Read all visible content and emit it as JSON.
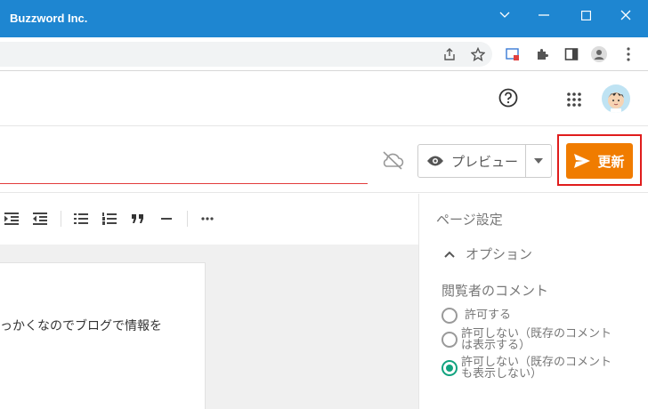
{
  "window": {
    "title": "Buzzword Inc."
  },
  "editor": {
    "preview_label": "プレビュー",
    "update_label": "更新",
    "body_text": "っかくなのでブログで情報を"
  },
  "sidebar": {
    "title": "ページ設定",
    "options_label": "オプション",
    "comments_label": "閲覧者のコメント",
    "radios": [
      {
        "line1": "許可する",
        "line2": "",
        "checked": false
      },
      {
        "line1": "許可しない（既存のコメント",
        "line2": "は表示する）",
        "checked": false
      },
      {
        "line1": "許可しない（既存のコメント",
        "line2": "も表示しない）",
        "checked": true
      }
    ]
  },
  "colors": {
    "titlebar": "#1e86d1",
    "accent": "#f07c00",
    "radio_checked": "#11a37f",
    "highlight": "#e01c1c"
  }
}
